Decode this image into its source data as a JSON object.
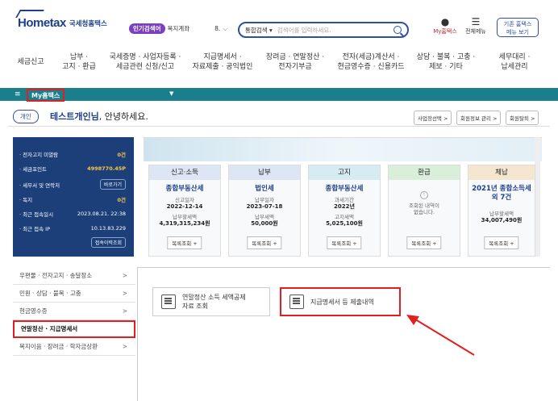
{
  "header": {
    "logo_text": "Hometax",
    "logo_sub": "국세청홈택스",
    "popular_badge": "인기검색어",
    "popular_term": "복지계좌",
    "popular_num": "8.",
    "search_scope": "통합검색",
    "search_placeholder": "검색어를 입력하세요.",
    "myhome_label": "My홈택스",
    "allmenu_label": "전체메뉴",
    "basic_label_1": "기존 홈택스",
    "basic_label_2": "메뉴 보기"
  },
  "gnb": [
    {
      "line1": "세금신고",
      "line2": ""
    },
    {
      "line1": "납부 ·",
      "line2": "고지 · 환급"
    },
    {
      "line1": "국세증명 · 사업자등록 ·",
      "line2": "세금관련 신청/신고"
    },
    {
      "line1": "지급명세서 ·",
      "line2": "자료제출 · 공익법인"
    },
    {
      "line1": "장려금 · 연말정산 ·",
      "line2": "전자기부금"
    },
    {
      "line1": "전자(세금)계산서 ·",
      "line2": "현금영수증 · 신용카드"
    },
    {
      "line1": "상담 · 불복 · 고충 ·",
      "line2": "제보 · 기타"
    },
    {
      "line1": "세무대리 ·",
      "line2": "납세관리"
    }
  ],
  "bar": {
    "my_label": "My홈택스"
  },
  "greeting": {
    "chip": "개인",
    "name": "테스트개인님",
    "suffix": ", 안녕하세요.",
    "btn1": "사업장선택 >",
    "btn2": "회원정보 관리 >",
    "btn3": "회원탈퇴 >"
  },
  "panel": [
    {
      "label": "· 전자고지 미열람",
      "value": "0건"
    },
    {
      "label": "· 세금포인트",
      "value": "4998770.45P"
    },
    {
      "label": "· 세무서 및 연락처",
      "value": "",
      "button": "바로가기"
    },
    {
      "label": "· 독지",
      "value": "0건"
    },
    {
      "label": "· 최근 접속일시",
      "value": "2023.08.21. 22:38"
    },
    {
      "label": "· 최근 접속 IP",
      "value": "10.13.83.229"
    }
  ],
  "panel_history_btn": "접속이력조회",
  "cards": [
    {
      "header": "신고·소득",
      "hcolor": "#dce6f5",
      "title": "종합부동산세",
      "sub1": "신고일자",
      "val1": "2022-12-14",
      "sub2": "납부할세액",
      "val2": "4,319,315,234원",
      "btn": "목록조회 +"
    },
    {
      "header": "납부",
      "hcolor": "#dce6f5",
      "title": "법인세",
      "sub1": "납부일자",
      "val1": "2023-07-18",
      "sub2": "납부세액",
      "val2": "50,000원",
      "btn": "목록조회 +"
    },
    {
      "header": "고지",
      "hcolor": "#d6ecf2",
      "title": "종합부동산세",
      "sub1": "과세기간",
      "val1": "2022년",
      "sub2": "고지세액",
      "val2": "5,025,100원",
      "btn": "목록조회 +"
    },
    {
      "header": "환급",
      "hcolor": "#d9efd9",
      "title": "",
      "sub1": "조회된 내역이",
      "val1": "",
      "sub2": "없습니다.",
      "val2": "",
      "btn": "목록조회 +"
    },
    {
      "header": "체납",
      "hcolor": "#f5e6cf",
      "title": "2021년 종합소득세 외 7건",
      "sub1": "납부할세액",
      "val1": "",
      "sub2": "",
      "val2": "34,007,490원",
      "btn": "목록조회 +"
    }
  ],
  "side": [
    {
      "label": "우편물 · 전자고지 · 송달장소"
    },
    {
      "label": "민원 · 상담 · 불복 · 고충"
    },
    {
      "label": "현금영수증"
    },
    {
      "label": "연말정산 · 지급명세서"
    },
    {
      "label": "복지이음 · 장려금 · 학자금상환"
    }
  ],
  "content": {
    "box1_line1": "연말정산 소득 세액공제",
    "box1_line2": "자료 조회",
    "box2": "지급명세서 등 제출내역"
  },
  "colors": {
    "accent": "#1a7f8d",
    "highlight": "#e02020",
    "brand": "#1d3f8c"
  }
}
